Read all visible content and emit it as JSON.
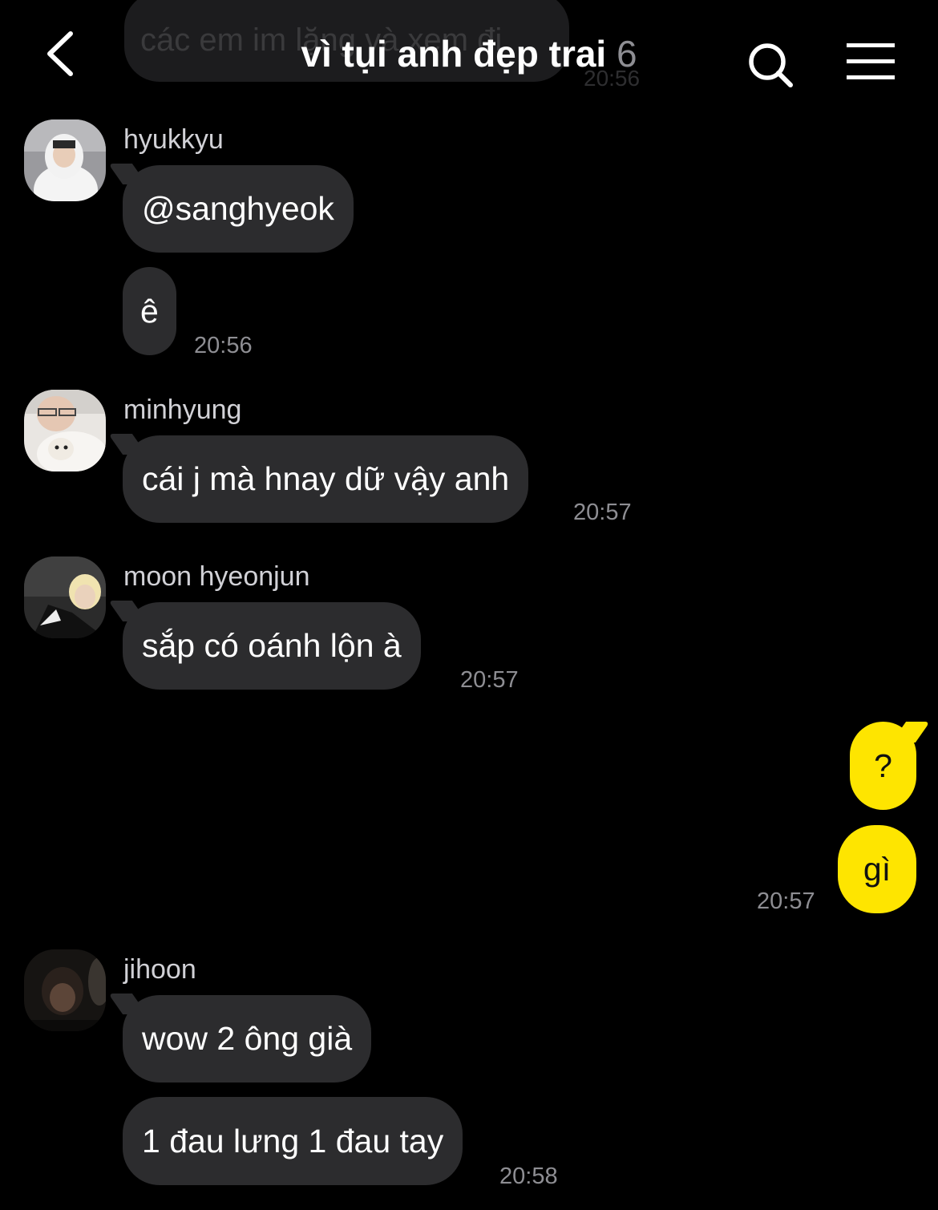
{
  "header": {
    "title": "vì tụi anh đẹp trai",
    "member_count": "6",
    "back_icon": "chevron-left-icon",
    "search_icon": "search-icon",
    "menu_icon": "menu-icon"
  },
  "previous_message": {
    "text": "các em im lặng và xem đi",
    "time": "20:56"
  },
  "messages": [
    {
      "sender": "hyukkyu",
      "bubbles": [
        "@sanghyeok",
        "ê"
      ],
      "time": "20:56"
    },
    {
      "sender": "minhyung",
      "bubbles": [
        "cái j mà hnay dữ vậy anh"
      ],
      "time": "20:57"
    },
    {
      "sender": "moon hyeonjun",
      "bubbles": [
        "sắp có oánh lộn à"
      ],
      "time": "20:57"
    },
    {
      "sender": "me",
      "bubbles": [
        "?",
        "gì"
      ],
      "time": "20:57"
    },
    {
      "sender": "jihoon",
      "bubbles": [
        "wow 2 ông già",
        "1 đau lưng 1 đau tay"
      ],
      "time": "20:58"
    }
  ],
  "colors": {
    "background": "#000000",
    "incoming_bubble": "#2c2c2e",
    "outgoing_bubble": "#fee500",
    "timestamp": "#8e8e93"
  }
}
